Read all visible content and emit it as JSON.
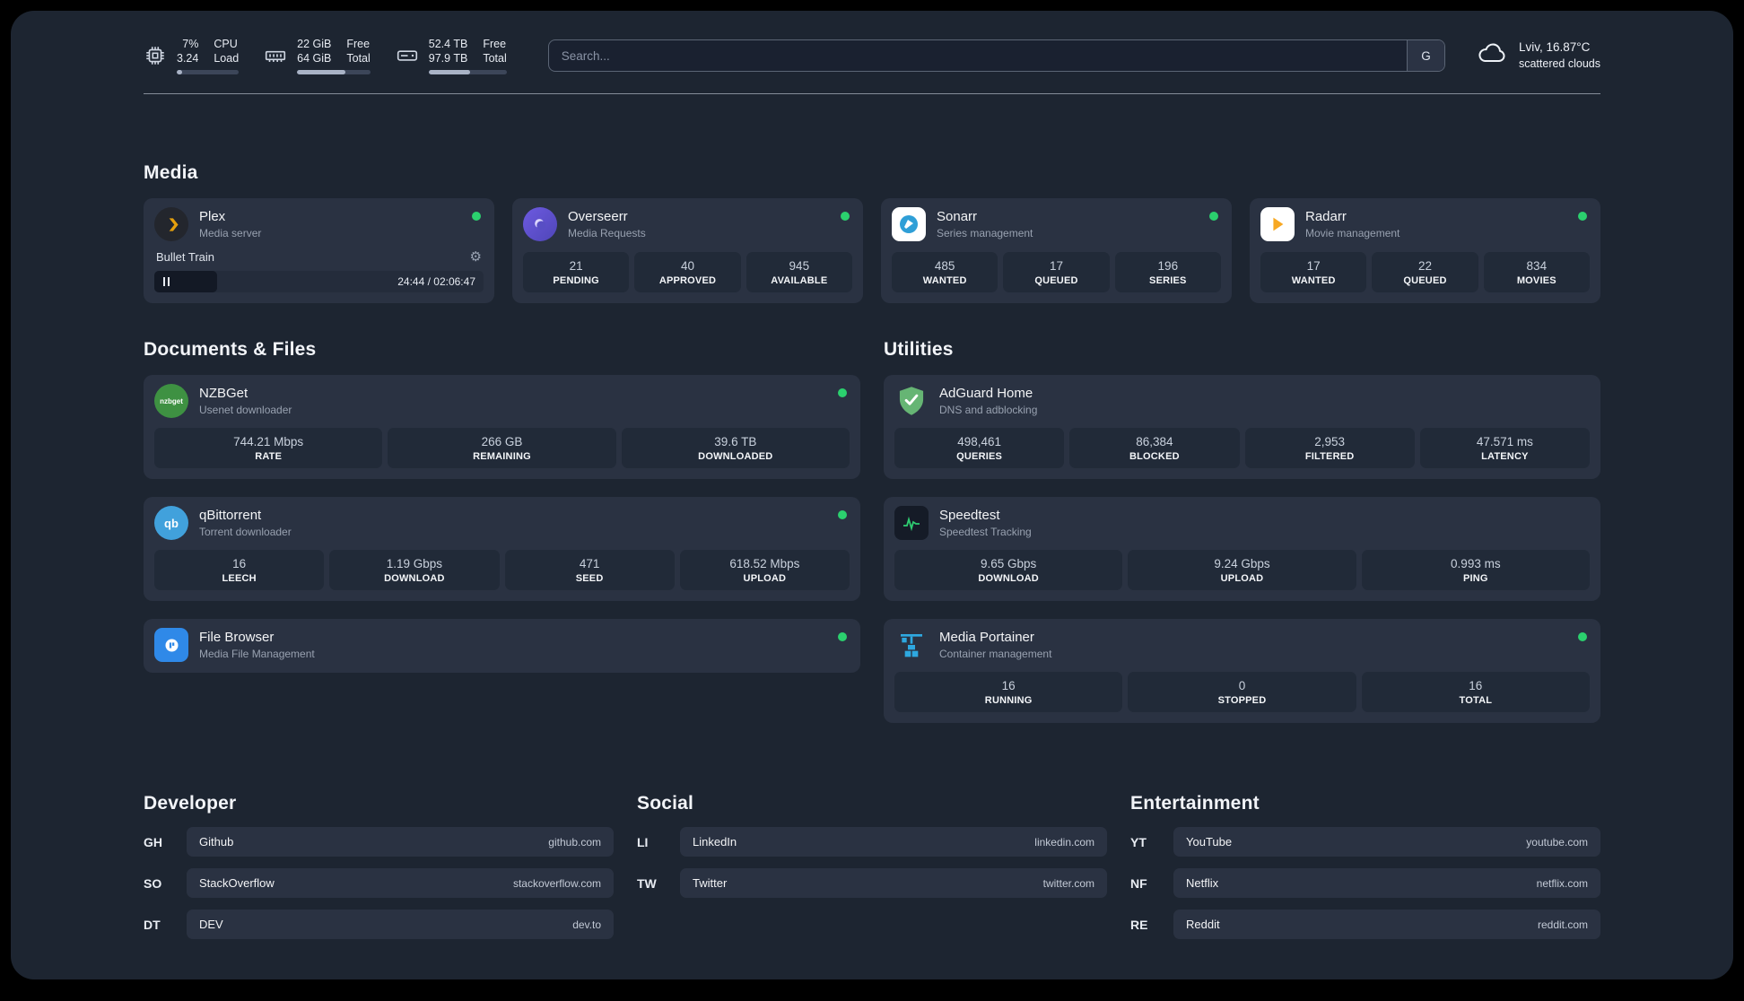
{
  "colors": {
    "background": "#1d2531",
    "card": "#2a3242",
    "stat_box": "#212a38",
    "status_green": "#2bd06e",
    "plex_amber": "#e5a00d",
    "adguard_green": "#66b574",
    "portainer_blue": "#2ea8e0"
  },
  "header": {
    "cpu": {
      "value1": "7%",
      "value2": "3.24",
      "label1": "CPU",
      "label2": "Load"
    },
    "memory": {
      "value1": "22 GiB",
      "value2": "64 GiB",
      "label1": "Free",
      "label2": "Total"
    },
    "disk": {
      "value1": "52.4 TB",
      "value2": "97.9 TB",
      "label1": "Free",
      "label2": "Total"
    },
    "search": {
      "placeholder": "Search...",
      "button": "G"
    },
    "weather": {
      "location": "Lviv, 16.87°C",
      "condition": "scattered clouds"
    }
  },
  "sections": {
    "media": {
      "title": "Media",
      "apps": [
        {
          "name": "Plex",
          "subtitle": "Media server",
          "player": {
            "track": "Bullet Train",
            "time": "24:44 / 02:06:47"
          }
        },
        {
          "name": "Overseerr",
          "subtitle": "Media Requests",
          "stats": [
            {
              "value": "21",
              "label": "PENDING"
            },
            {
              "value": "40",
              "label": "APPROVED"
            },
            {
              "value": "945",
              "label": "AVAILABLE"
            }
          ]
        },
        {
          "name": "Sonarr",
          "subtitle": "Series management",
          "stats": [
            {
              "value": "485",
              "label": "WANTED"
            },
            {
              "value": "17",
              "label": "QUEUED"
            },
            {
              "value": "196",
              "label": "SERIES"
            }
          ]
        },
        {
          "name": "Radarr",
          "subtitle": "Movie management",
          "stats": [
            {
              "value": "17",
              "label": "WANTED"
            },
            {
              "value": "22",
              "label": "QUEUED"
            },
            {
              "value": "834",
              "label": "MOVIES"
            }
          ]
        }
      ]
    },
    "documents": {
      "title": "Documents & Files",
      "apps": [
        {
          "name": "NZBGet",
          "subtitle": "Usenet downloader",
          "stats": [
            {
              "value": "744.21 Mbps",
              "label": "RATE"
            },
            {
              "value": "266 GB",
              "label": "REMAINING"
            },
            {
              "value": "39.6 TB",
              "label": "DOWNLOADED"
            }
          ]
        },
        {
          "name": "qBittorrent",
          "subtitle": "Torrent downloader",
          "stats": [
            {
              "value": "16",
              "label": "LEECH"
            },
            {
              "value": "1.19 Gbps",
              "label": "DOWNLOAD"
            },
            {
              "value": "471",
              "label": "SEED"
            },
            {
              "value": "618.52 Mbps",
              "label": "UPLOAD"
            }
          ]
        },
        {
          "name": "File Browser",
          "subtitle": "Media File Management"
        }
      ]
    },
    "utilities": {
      "title": "Utilities",
      "apps": [
        {
          "name": "AdGuard Home",
          "subtitle": "DNS and adblocking",
          "stats": [
            {
              "value": "498,461",
              "label": "QUERIES"
            },
            {
              "value": "86,384",
              "label": "BLOCKED"
            },
            {
              "value": "2,953",
              "label": "FILTERED"
            },
            {
              "value": "47.571 ms",
              "label": "LATENCY"
            }
          ]
        },
        {
          "name": "Speedtest",
          "subtitle": "Speedtest Tracking",
          "stats": [
            {
              "value": "9.65 Gbps",
              "label": "DOWNLOAD"
            },
            {
              "value": "9.24 Gbps",
              "label": "UPLOAD"
            },
            {
              "value": "0.993 ms",
              "label": "PING"
            }
          ]
        },
        {
          "name": "Media Portainer",
          "subtitle": "Container management",
          "stats": [
            {
              "value": "16",
              "label": "RUNNING"
            },
            {
              "value": "0",
              "label": "STOPPED"
            },
            {
              "value": "16",
              "label": "TOTAL"
            }
          ]
        }
      ]
    }
  },
  "bookmarks": [
    {
      "title": "Developer",
      "items": [
        {
          "abbr": "GH",
          "name": "Github",
          "domain": "github.com"
        },
        {
          "abbr": "SO",
          "name": "StackOverflow",
          "domain": "stackoverflow.com"
        },
        {
          "abbr": "DT",
          "name": "DEV",
          "domain": "dev.to"
        }
      ]
    },
    {
      "title": "Social",
      "items": [
        {
          "abbr": "LI",
          "name": "LinkedIn",
          "domain": "linkedin.com"
        },
        {
          "abbr": "TW",
          "name": "Twitter",
          "domain": "twitter.com"
        }
      ]
    },
    {
      "title": "Entertainment",
      "items": [
        {
          "abbr": "YT",
          "name": "YouTube",
          "domain": "youtube.com"
        },
        {
          "abbr": "NF",
          "name": "Netflix",
          "domain": "netflix.com"
        },
        {
          "abbr": "RE",
          "name": "Reddit",
          "domain": "reddit.com"
        }
      ]
    }
  ]
}
